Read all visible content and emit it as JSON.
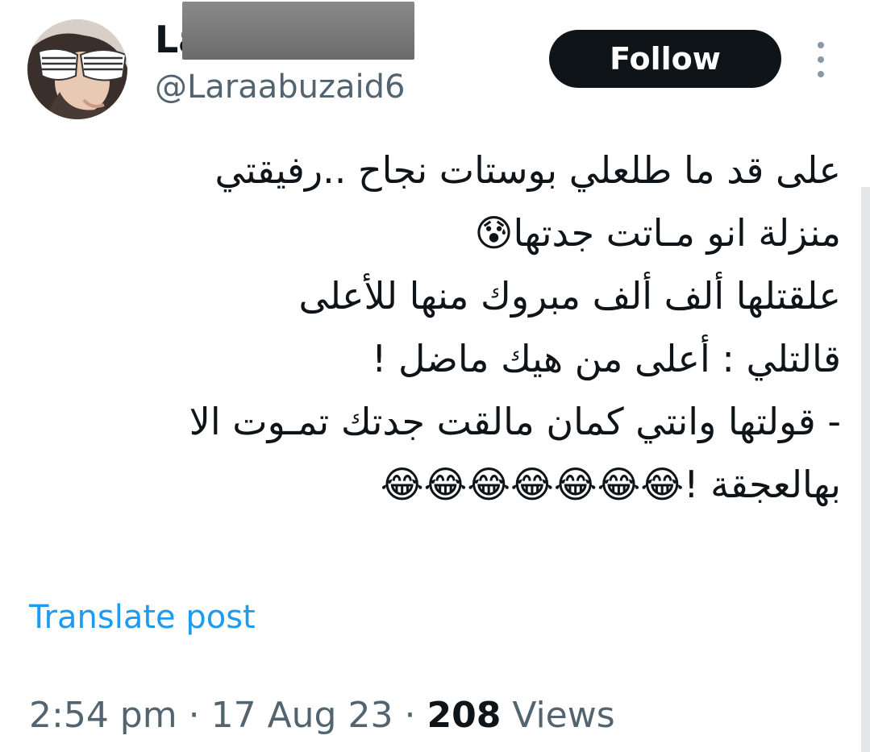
{
  "author": {
    "display_name_visible": "La",
    "handle": "@Laraabuzaid6",
    "avatar": "user-avatar-with-shutter-shades"
  },
  "actions": {
    "follow_label": "Follow",
    "more_icon": "more-vertical-icon"
  },
  "tweet": {
    "lines": [
      "على قد ما طلعلي بوستات نجاح ..رفيقتي",
      "منزلة انو مـاتت جدتها😰",
      "علقتلها ألف ألف مبروك منها للأعلى",
      "قالتلي : أعلى من هيك ماضل !",
      "- قولتها وانتي كمان مالقت جدتك تمـوت الا",
      "بهالعجقة !😂😂😂😂😂😂😂"
    ]
  },
  "translate_label": "Translate post",
  "meta": {
    "time": "2:54 pm",
    "date": "17 Aug 23",
    "separator": "·",
    "views_count": "208",
    "views_label": "Views"
  },
  "colors": {
    "text_primary": "#0f1419",
    "text_secondary": "#536471",
    "link": "#1d9bf0",
    "button_bg": "#0f1419"
  }
}
